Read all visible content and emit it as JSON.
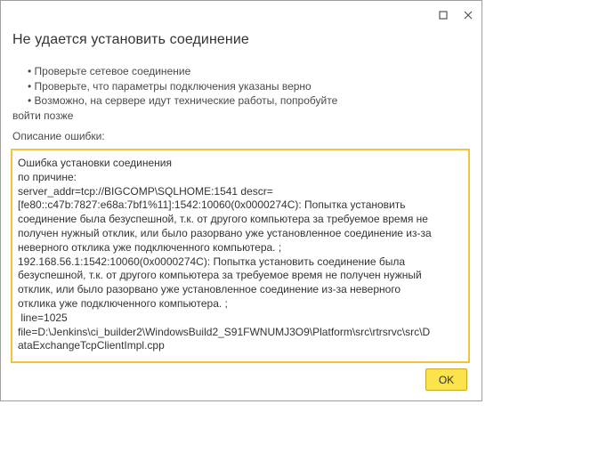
{
  "dialog": {
    "title": "Не удается установить соединение",
    "hints": [
      "• Проверьте сетевое соединение",
      "• Проверьте, что параметры подключения указаны верно",
      "• Возможно, на сервере идут технические работы, попробуйте"
    ],
    "hint_continuation": "войти позже",
    "description_label": "Описание ошибки:",
    "error_text": "Ошибка установки соединения\nпо причине:\nserver_addr=tcp://BIGCOMP\\SQLHOME:1541 descr=\n[fe80::c47b:7827:e68a:7bf1%11]:1542:10060(0x0000274C): Попытка установить\nсоединение была безуспешной, т.к. от другого компьютера за требуемое время не\nполучен нужный отклик, или было разорвано уже установленное соединение из-за\nневерного отклика уже подключенного компьютера. ;\n192.168.56.1:1542:10060(0x0000274C): Попытка установить соединение была\nбезуспешной, т.к. от другого компьютера за требуемое время не получен нужный\nотклик, или было разорвано уже установленное соединение из-за неверного\nотклика уже подключенного компьютера. ;\n line=1025\nfile=D:\\Jenkins\\ci_builder2\\WindowsBuild2_S91FWNUMJ3O9\\Platform\\src\\rtrsrvc\\src\\D\nataExchangeTcpClientImpl.cpp",
    "ok_label": "OK"
  },
  "icons": {
    "maximize": "maximize-icon",
    "close": "close-icon"
  },
  "colors": {
    "accent_border": "#f2c43d",
    "ok_button": "#fbe34c"
  }
}
